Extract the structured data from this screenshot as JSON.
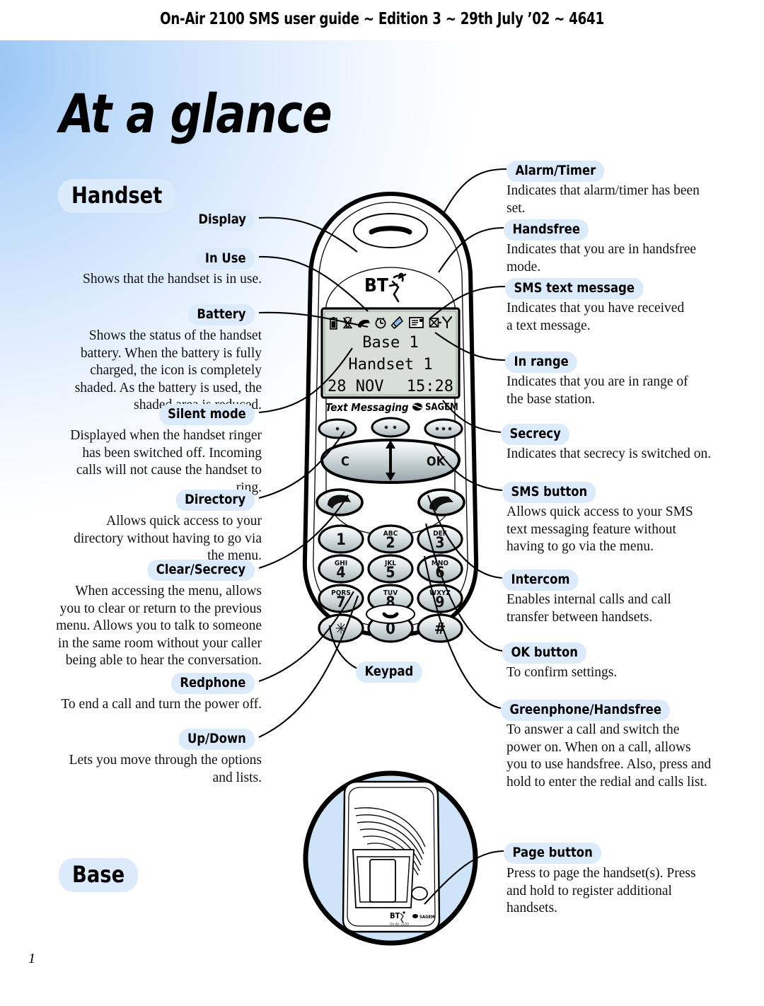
{
  "header": {
    "running_head": "On-Air 2100 SMS user guide ~ Edition 3 ~ 29th July ’02 ~ 4641"
  },
  "page": {
    "title": "At a glance",
    "number": "1"
  },
  "sections": {
    "handset": "Handset",
    "base": "Base"
  },
  "left_callouts": [
    {
      "label": "Display",
      "text": ""
    },
    {
      "label": "In Use",
      "text": "Shows that the handset is in use."
    },
    {
      "label": "Battery",
      "text": "Shows the status of the handset battery. When the battery is fully charged, the icon is completely shaded. As the battery is used, the shaded area is reduced."
    },
    {
      "label": "Silent mode",
      "text": "Displayed when the handset ringer has been switched off. Incoming calls will not cause the handset to ring."
    },
    {
      "label": "Directory",
      "text": "Allows quick access to your directory without having to go via the menu."
    },
    {
      "label": "Clear/Secrecy",
      "text": "When accessing the menu, allows you to clear or return to the previous menu. Allows you to talk to someone in the same room without your caller being able to hear the conversation."
    },
    {
      "label": "Redphone",
      "text": "To end a call and turn the power off."
    },
    {
      "label": "Up/Down",
      "text": "Lets you move through the options and lists."
    }
  ],
  "center_callouts": [
    {
      "label": "Keypad",
      "text": ""
    }
  ],
  "right_callouts": [
    {
      "label": "Alarm/Timer",
      "text": "Indicates that alarm/timer has been set."
    },
    {
      "label": "Handsfree",
      "text": "Indicates that you are in handsfree mode."
    },
    {
      "label": "SMS text message",
      "text": "Indicates that you have received a text message."
    },
    {
      "label": "In range",
      "text": "Indicates that you are in range of the base station."
    },
    {
      "label": "Secrecy",
      "text": "Indicates that secrecy is switched on."
    },
    {
      "label": "SMS button",
      "text": "Allows quick access to your SMS text messaging feature without having to go via the menu."
    },
    {
      "label": "Intercom",
      "text": "Enables internal calls and call transfer between handsets."
    },
    {
      "label": "OK button",
      "text": "To confirm settings."
    },
    {
      "label": "Greenphone/Handsfree",
      "text": "To answer a call and switch the power on. When on a call, allows you to use handsfree. Also, press and hold to enter the redial and calls list."
    },
    {
      "label": "Page button",
      "text": "Press to page the handset(s). Press and hold to register additional handsets."
    }
  ],
  "handset_display": {
    "line1": "Base 1",
    "line2": "Handset 1",
    "date": "28 NOV",
    "time": "15:28",
    "status_icons": [
      "battery-icon",
      "silent-mode-icon",
      "in-use-icon",
      "alarm-timer-icon",
      "handsfree-icon",
      "sms-message-icon",
      "secrecy-icon",
      "in-range-icon"
    ]
  },
  "handset_branding": {
    "bt_logo": "BT",
    "text_messaging": "Text Messaging",
    "sagem": "SAGEM"
  },
  "keypad": {
    "softkeys": {
      "clear": "C",
      "ok": "OK"
    },
    "keys": [
      {
        "digit": "1",
        "letters": ""
      },
      {
        "digit": "2",
        "letters": "ABC"
      },
      {
        "digit": "3",
        "letters": "DEF"
      },
      {
        "digit": "4",
        "letters": "GHI"
      },
      {
        "digit": "5",
        "letters": "JKL"
      },
      {
        "digit": "6",
        "letters": "MNO"
      },
      {
        "digit": "7",
        "letters": "PQRS"
      },
      {
        "digit": "8",
        "letters": "TUV"
      },
      {
        "digit": "9",
        "letters": "WXYZ"
      },
      {
        "digit": "✳",
        "letters": ""
      },
      {
        "digit": "0",
        "letters": ""
      },
      {
        "digit": "#",
        "letters": ""
      }
    ]
  },
  "base_branding": {
    "bt_logo": "BT"
  },
  "colors": {
    "pill_bg": "#dcebfb",
    "page_gradient_from": "#8fc0f4",
    "page_gradient_to": "#ffffff",
    "lcd_bg": "#d8dfd9",
    "key_face": "#c9d2d4"
  }
}
